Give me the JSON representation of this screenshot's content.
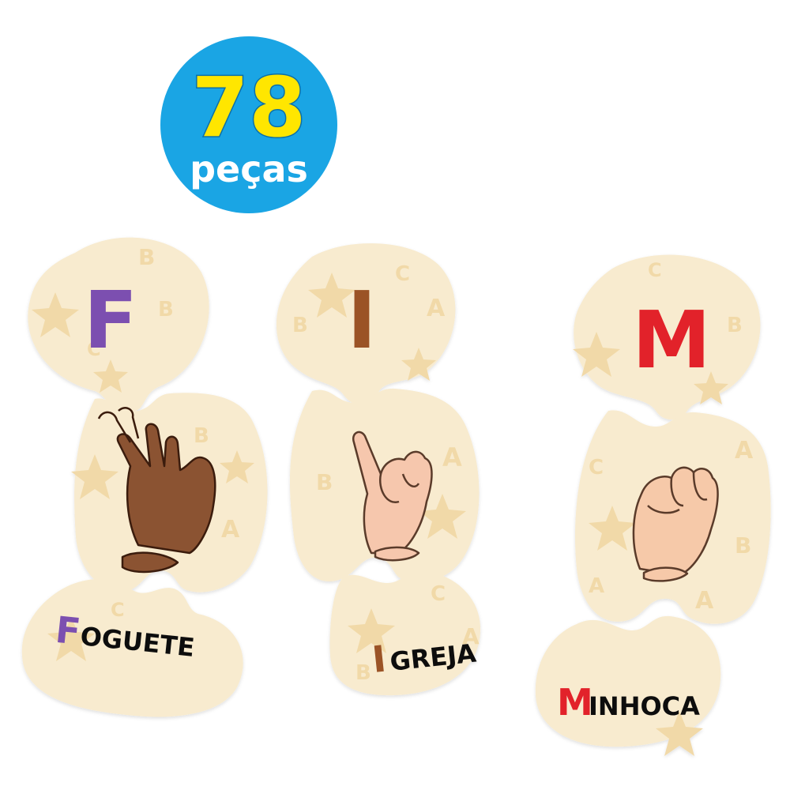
{
  "badge": {
    "count": "78",
    "label": "peças",
    "circle_color": "#1aa5e4",
    "count_color": "#ffe600",
    "label_color": "#ffffff"
  },
  "puzzle_background_color": "#f8ebcf",
  "puzzle_pattern_color": "#f1d9a8",
  "words": [
    {
      "letter": "F",
      "letter_color": "#7b4fb0",
      "word_initial": "F",
      "word_rest": "OGUETE",
      "hand_skin": "#8b5233",
      "hand_sign": "letter-f-sign"
    },
    {
      "letter": "I",
      "letter_color": "#9b5226",
      "word_initial": "I",
      "word_rest": "GREJA",
      "hand_skin": "#f6c7ad",
      "hand_sign": "letter-i-sign"
    },
    {
      "letter": "M",
      "letter_color": "#e2242b",
      "word_initial": "M",
      "word_rest": "INHOCA",
      "hand_skin": "#f6c9a9",
      "hand_sign": "letter-m-sign"
    }
  ]
}
